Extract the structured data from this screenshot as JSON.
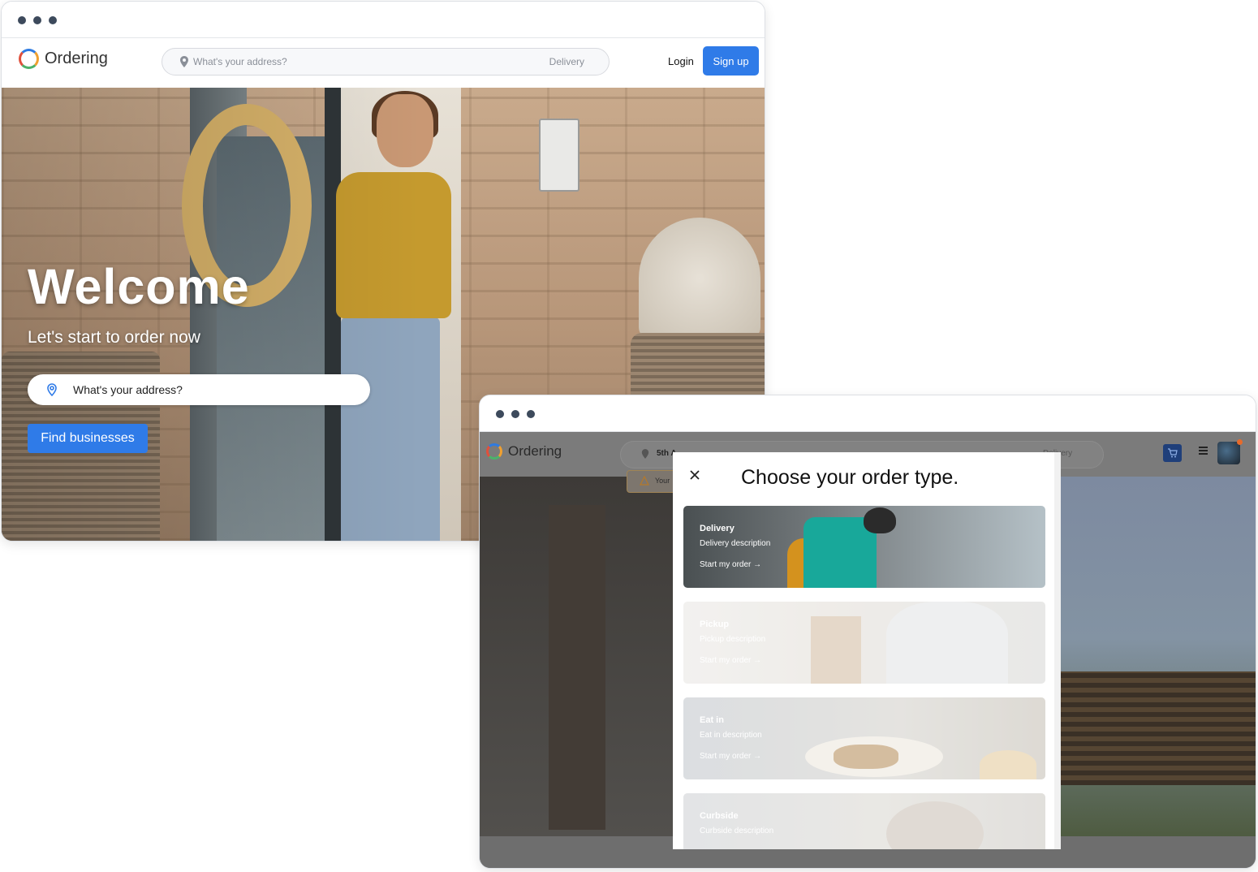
{
  "window1": {
    "logo_text": "Ordering",
    "search": {
      "placeholder": "What's your address?",
      "mode": "Delivery"
    },
    "login_label": "Login",
    "signup_label": "Sign up",
    "hero": {
      "title": "Welcome",
      "subtitle": "Let's start to order now",
      "address_placeholder": "What's your address?",
      "find_button": "Find businesses"
    }
  },
  "window2": {
    "logo_text": "Ordering",
    "header": {
      "address": "5th A",
      "mode": "Delivery",
      "warning_text": "Your"
    },
    "modal": {
      "title": "Choose your order type.",
      "cards": [
        {
          "title": "Delivery",
          "description": "Delivery description",
          "cta": "Start my order →"
        },
        {
          "title": "Pickup",
          "description": "Pickup description",
          "cta": "Start my order →"
        },
        {
          "title": "Eat in",
          "description": "Eat in description",
          "cta": "Start my order →"
        },
        {
          "title": "Curbside",
          "description": "Curbside description"
        }
      ]
    }
  },
  "colors": {
    "primary": "#2f7be8",
    "logo_ring": [
      "#2e7be2",
      "#f0a030",
      "#4cb26a",
      "#e0503c"
    ]
  },
  "icons": [
    "location-pin-icon",
    "close-icon",
    "cart-icon",
    "menu-icon",
    "warning-icon"
  ]
}
